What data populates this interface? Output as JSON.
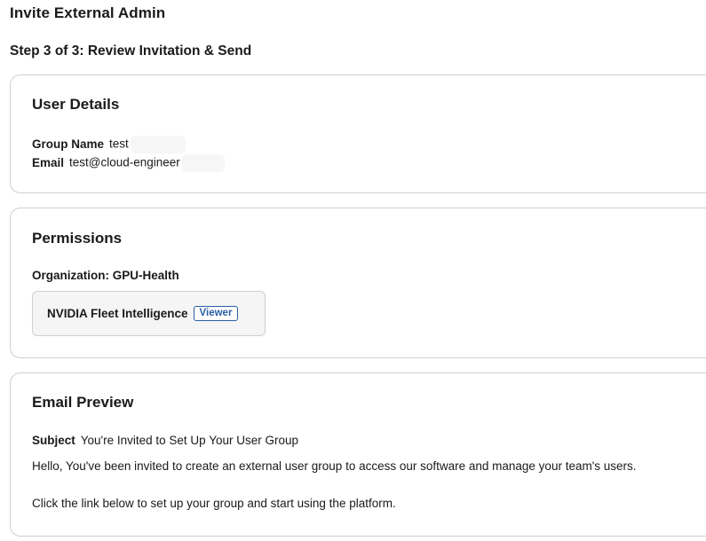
{
  "page": {
    "title": "Invite External Admin",
    "step": "Step 3 of 3: Review Invitation & Send"
  },
  "user_details": {
    "heading": "User Details",
    "group_name_label": "Group Name",
    "group_name_value": "test",
    "email_label": "Email",
    "email_value": "test@cloud-engineer"
  },
  "permissions": {
    "heading": "Permissions",
    "organization_label": "Organization: GPU-Health",
    "app_name": "NVIDIA Fleet Intelligence",
    "role_badge": "Viewer"
  },
  "email_preview": {
    "heading": "Email Preview",
    "subject_label": "Subject",
    "subject_value": "You're Invited to Set Up Your User Group",
    "body_line_1": "Hello, You've been invited to create an external user group to access our software and manage your team's users.",
    "body_line_2": "Click the link below to set up your group and start using the platform."
  },
  "colors": {
    "badge": "#2a5fa8",
    "card_border": "#cfcfcf",
    "tile_bg": "#f5f5f5"
  }
}
